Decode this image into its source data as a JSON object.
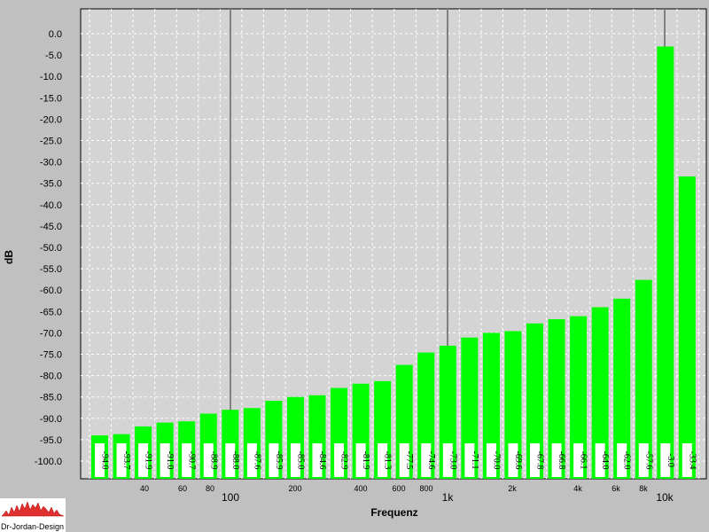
{
  "chart_data": {
    "type": "bar",
    "xlabel": "Frequenz",
    "ylabel": "dB",
    "ylim": [
      -100,
      0
    ],
    "yticks": [
      "0.0",
      "-5.0",
      "-10.0",
      "-15.0",
      "-20.0",
      "-25.0",
      "-30.0",
      "-35.0",
      "-40.0",
      "-45.0",
      "-50.0",
      "-55.0",
      "-60.0",
      "-65.0",
      "-70.0",
      "-75.0",
      "-80.0",
      "-85.0",
      "-90.0",
      "-95.0",
      "-100.0"
    ],
    "x_tick_labels_minor": [
      "40",
      "60",
      "80",
      "200",
      "400",
      "600",
      "800",
      "2k",
      "4k",
      "6k",
      "8k"
    ],
    "x_tick_labels_major": [
      "100",
      "1k",
      "10k"
    ],
    "grid": true,
    "bar_color": "#00ff00",
    "values": [
      -94.0,
      -93.7,
      -91.9,
      -91.0,
      -90.7,
      -88.9,
      -88.0,
      -87.6,
      -85.9,
      -85.0,
      -84.6,
      -82.9,
      -81.9,
      -81.3,
      -77.5,
      -74.6,
      -73.0,
      -71.1,
      -70.0,
      -69.6,
      -67.8,
      -66.8,
      -66.1,
      -64.0,
      -62.0,
      -57.6,
      -3.0,
      -33.4
    ],
    "labels": [
      "-94.0",
      "-93.7",
      "-91.9",
      "-91.0",
      "-90.7",
      "-88.9",
      "-88.0",
      "-87.6",
      "-85.9",
      "-85.0",
      "-84.6",
      "-82.9",
      "-81.9",
      "-81.3",
      "-77.5",
      "-74.6",
      "-73.0",
      "-71.1",
      "-70.0",
      "-69.6",
      "-67.8",
      "-66.8",
      "-66.1",
      "-64.0",
      "-62.0",
      "-57.6",
      "-3.0",
      "-33.4"
    ]
  },
  "logo": {
    "text": "Dr-Jordan-Design"
  }
}
